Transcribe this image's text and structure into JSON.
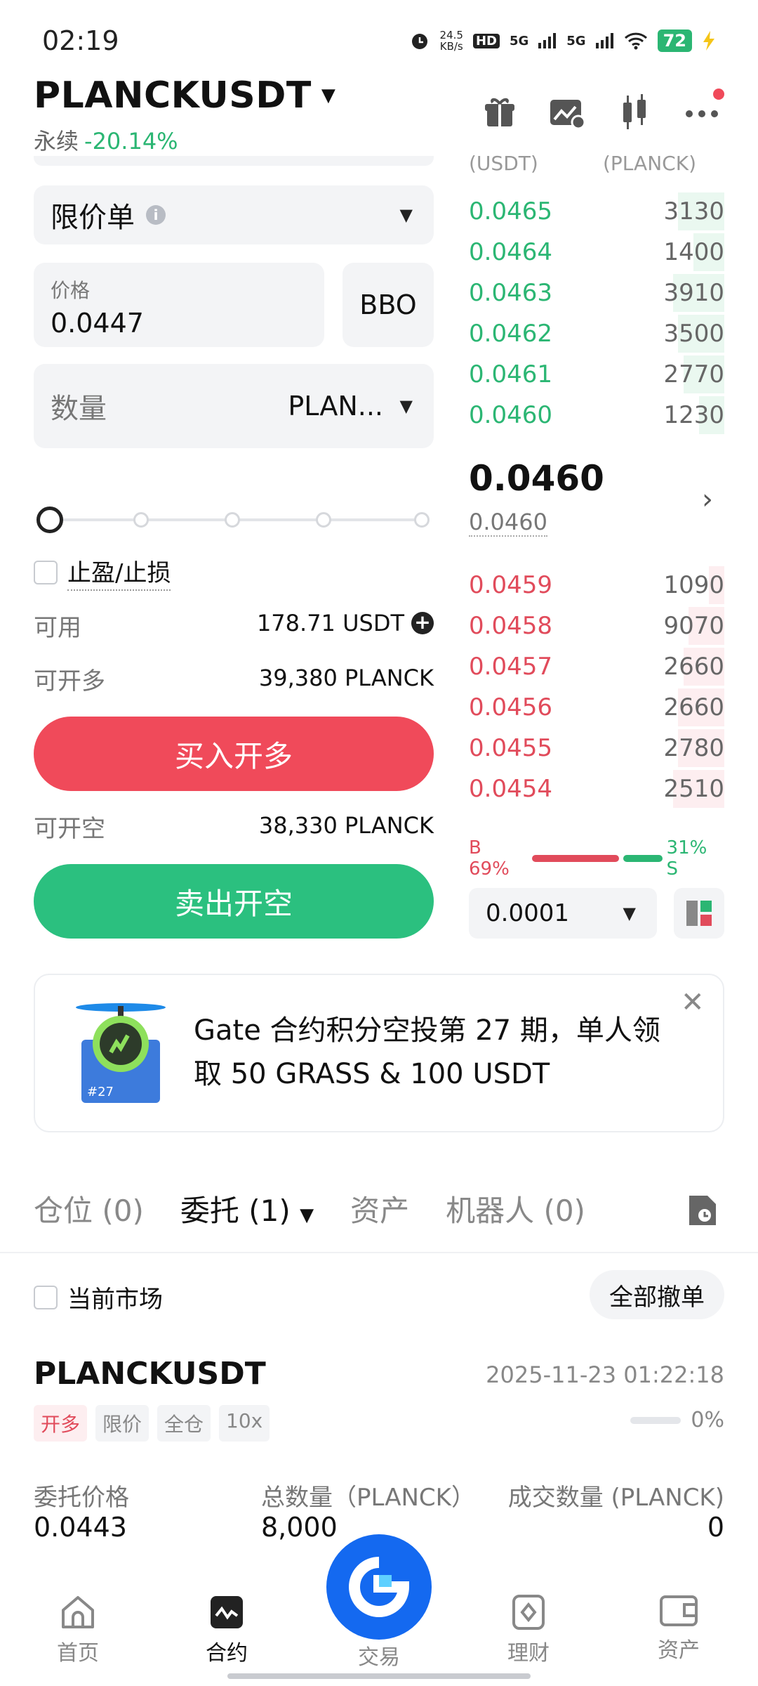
{
  "status_bar": {
    "time": "02:19",
    "net_speed_value": "24.5",
    "net_speed_unit": "KB/s",
    "hd_label": "HD",
    "sig1": "5G",
    "sig2": "5G",
    "battery": "72"
  },
  "header": {
    "symbol": "PLANCKUSDT",
    "contract_type": "永续",
    "change_pct": "-20.14%",
    "icons": [
      "gift-icon",
      "chart-icon",
      "candlestick-icon",
      "more-icon"
    ]
  },
  "form": {
    "order_type": "限价单",
    "price_label": "价格",
    "price_value": "0.0447",
    "bbo_label": "BBO",
    "qty_placeholder": "数量",
    "qty_unit": "PLAN...",
    "slider_level": 0,
    "tpsl_label": "止盈/止损",
    "available_label": "可用",
    "available_value": "178.71  USDT",
    "open_long_label": "可开多",
    "open_long_value": "39,380 PLANCK",
    "buy_button": "买入开多",
    "open_short_label": "可开空",
    "open_short_value": "38,330 PLANCK",
    "sell_button": "卖出开空"
  },
  "orderbook": {
    "head_price": "(USDT)",
    "head_amount": "(PLANCK)",
    "asks": [
      {
        "price": "0.0465",
        "amount": "3130",
        "depth": 0.18
      },
      {
        "price": "0.0464",
        "amount": "1400",
        "depth": 0.12
      },
      {
        "price": "0.0463",
        "amount": "3910",
        "depth": 0.2
      },
      {
        "price": "0.0462",
        "amount": "3500",
        "depth": 0.18
      },
      {
        "price": "0.0461",
        "amount": "2770",
        "depth": 0.16
      },
      {
        "price": "0.0460",
        "amount": "1230",
        "depth": 0.1
      }
    ],
    "last_price": "0.0460",
    "mark_price": "0.0460",
    "bids": [
      {
        "price": "0.0459",
        "amount": "1090",
        "depth": 0.06
      },
      {
        "price": "0.0458",
        "amount": "9070",
        "depth": 0.14
      },
      {
        "price": "0.0457",
        "amount": "2660",
        "depth": 0.16
      },
      {
        "price": "0.0456",
        "amount": "2660",
        "depth": 0.18
      },
      {
        "price": "0.0455",
        "amount": "2780",
        "depth": 0.18
      },
      {
        "price": "0.0454",
        "amount": "2510",
        "depth": 0.2
      }
    ],
    "buy_ratio_label": "B 69%",
    "sell_ratio_label": "31% S",
    "buy_ratio": 0.69,
    "precision": "0.0001"
  },
  "banner": {
    "badge": "#27",
    "text": "Gate 合约积分空投第 27 期，单人领取 50 GRASS & 100 USDT"
  },
  "tabs": {
    "positions": "仓位 (0)",
    "orders": "委托 (1)",
    "assets": "资产",
    "bots": "机器人 (0)"
  },
  "filters": {
    "current_market": "当前市场",
    "cancel_all": "全部撤单"
  },
  "order": {
    "symbol": "PLANCKUSDT",
    "time": "2025-11-23 01:22:18",
    "tags": [
      "开多",
      "限价",
      "全仓",
      "10x"
    ],
    "fill_pct": "0%",
    "price_label": "委托价格",
    "price_value": "0.0443",
    "total_label": "总数量（PLANCK）",
    "total_value": "8,000",
    "filled_label": "成交数量 (PLANCK)",
    "filled_value": "0"
  },
  "nav": {
    "home": "首页",
    "contract": "合约",
    "trade": "交易",
    "finance": "理财",
    "assets": "资产"
  },
  "colors": {
    "green": "#2bb673",
    "red": "#e14b5b",
    "brand_blue": "#1469f0"
  }
}
